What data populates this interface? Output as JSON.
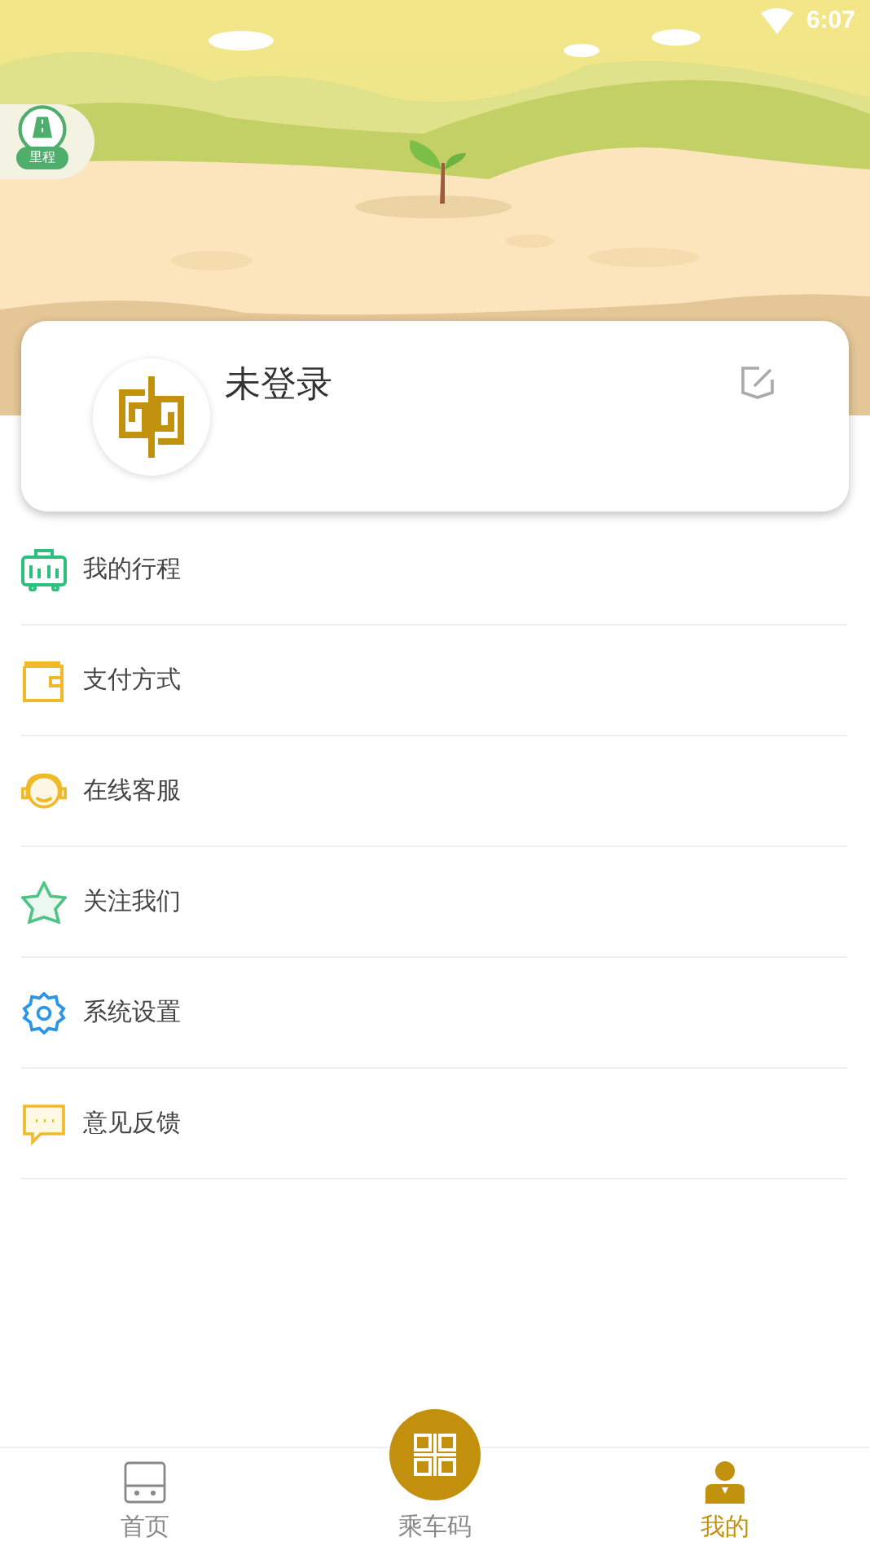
{
  "status_bar": {
    "time": "6:07"
  },
  "mileage_badge": {
    "label": "里程"
  },
  "profile": {
    "name": "未登录"
  },
  "menu": [
    {
      "kind": "trips",
      "label": "我的行程"
    },
    {
      "kind": "wallet",
      "label": "支付方式"
    },
    {
      "kind": "service",
      "label": "在线客服"
    },
    {
      "kind": "follow",
      "label": "关注我们"
    },
    {
      "kind": "settings",
      "label": "系统设置"
    },
    {
      "kind": "feedback",
      "label": "意见反馈"
    }
  ],
  "bottom_nav": [
    {
      "kind": "home",
      "label": "首页",
      "selected": false
    },
    {
      "kind": "code",
      "label": "乘车码",
      "selected": false
    },
    {
      "kind": "me",
      "label": "我的",
      "selected": true
    }
  ]
}
